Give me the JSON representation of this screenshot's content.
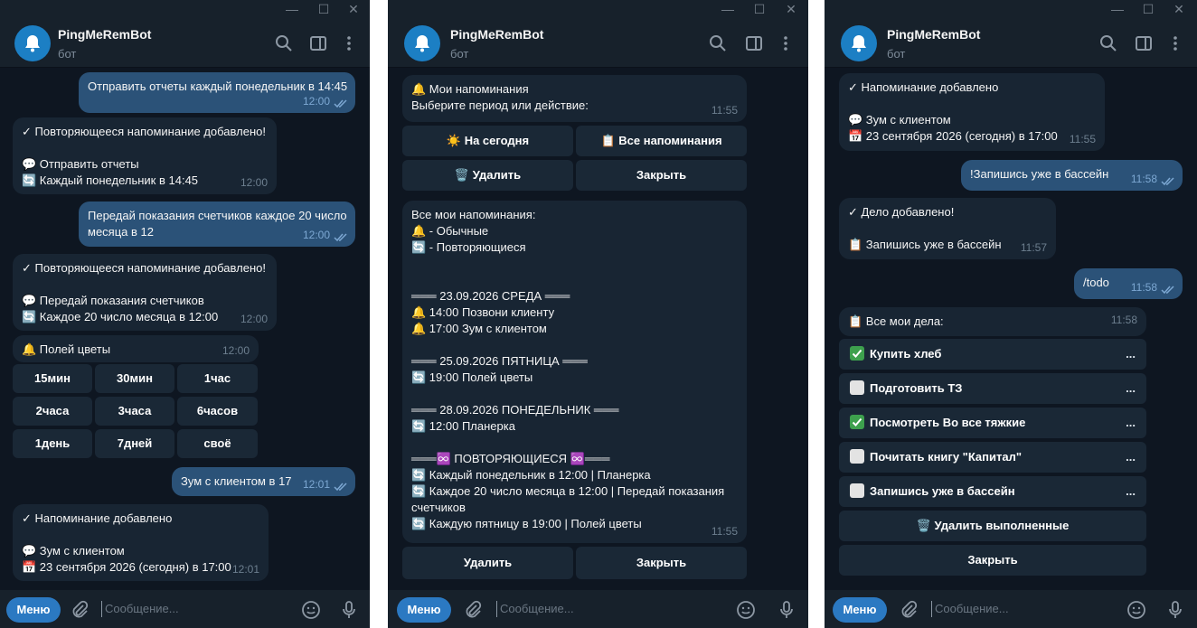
{
  "bot": {
    "name": "PingMeRemBot",
    "status": "бот"
  },
  "footer": {
    "menu_label": "Меню",
    "input_placeholder": "Сообщение..."
  },
  "window1": {
    "messages": [
      {
        "lines": [
          "Отправить отчеты каждый понедельник в 14:45"
        ],
        "time": "12:00"
      },
      {
        "lines": [
          "✓ Повторяющееся напоминание добавлено!",
          "",
          "💬 Отправить отчеты",
          "🔄 Каждый понедельник в 14:45"
        ],
        "time": "12:00"
      },
      {
        "lines": [
          "Передай показания счетчиков каждое 20 число",
          "месяца в 12"
        ],
        "time": "12:00"
      },
      {
        "lines": [
          "✓ Повторяющееся напоминание добавлено!",
          "",
          "💬 Передай показания счетчиков",
          "🔄 Каждое 20 число месяца в 12:00"
        ],
        "time": "12:00"
      },
      {
        "lines": [
          "🔔 Полей цветы"
        ],
        "time": "12:00"
      },
      {
        "lines": [
          "Зум с клиентом в 17"
        ],
        "time": "12:01"
      },
      {
        "lines": [
          "✓ Напоминание добавлено",
          "",
          "💬 Зум с клиентом",
          "📅 23 сентября 2026 (сегодня) в 17:00"
        ],
        "time": "12:01"
      }
    ],
    "snooze_buttons": [
      "15мин",
      "30мин",
      "1час",
      "2часа",
      "3часа",
      "6часов",
      "1день",
      "7дней",
      "своё"
    ]
  },
  "window2": {
    "messages": [
      {
        "lines": [
          "🔔 Мои напоминания",
          "Выберите период или действие:"
        ],
        "time": "11:55"
      },
      {
        "lines": [
          "Все мои напоминания:",
          "🔔 - Обычные",
          "🔄 - Повторяющиеся",
          "",
          "",
          "═══ 23.09.2026 СРЕДА ═══",
          "🔔 14:00 Позвони клиенту",
          "🔔 17:00 Зум с клиентом",
          "",
          "═══ 25.09.2026 ПЯТНИЦА ═══",
          "🔄 19:00 Полей цветы",
          "",
          "═══ 28.09.2026 ПОНЕДЕЛЬНИК ═══",
          "🔄 12:00 Планерка",
          "",
          "═══♾️ ПОВТОРЯЮЩИЕСЯ ♾️═══",
          "🔄 Каждый понедельник в 12:00 | Планерка",
          "🔄 Каждое 20 число месяца в 12:00 | Передай показания",
          "счетчиков",
          "🔄 Каждую пятницу в 19:00 | Полей цветы"
        ],
        "time": "11:55"
      }
    ],
    "menu_buttons": [
      "☀️ На сегодня",
      "📋 Все напоминания",
      "🗑️ Удалить",
      "Закрыть"
    ],
    "bottom_buttons": [
      "Удалить",
      "Закрыть"
    ]
  },
  "window3": {
    "messages": [
      {
        "lines": [
          "✓ Напоминание добавлено",
          "",
          "💬 Зум с клиентом",
          "📅 23 сентября 2026 (сегодня) в 17:00"
        ],
        "time": "11:55"
      },
      {
        "lines": [
          "!Запишись уже в бассейн"
        ],
        "time": "11:58"
      },
      {
        "lines": [
          "✓ Дело добавлено!",
          "",
          "📋 Запишись уже в бассейн"
        ],
        "time": "11:57"
      },
      {
        "lines": [
          "/todo"
        ],
        "time": "11:58"
      },
      {
        "lines": [
          "📋 Все мои дела:"
        ],
        "time": "11:58"
      }
    ],
    "todos": [
      {
        "label": "Купить хлеб",
        "done": true,
        "more": "..."
      },
      {
        "label": "Подготовить ТЗ",
        "done": false,
        "more": "..."
      },
      {
        "label": "Посмотреть Во все тяжкие",
        "done": true,
        "more": "..."
      },
      {
        "label": "Почитать книгу \"Капитал\"",
        "done": false,
        "more": "..."
      },
      {
        "label": "Запишись уже в бассейн",
        "done": false,
        "more": "..."
      }
    ],
    "actions": [
      "🗑️ Удалить выполненные",
      "Закрыть"
    ]
  },
  "colors": {
    "chat_bg": "#0e1621",
    "header_bg": "#17212b",
    "incoming": "#182533",
    "outgoing": "#2b5278",
    "accent": "#2b79c2",
    "keyboard_button": "#1a2836"
  }
}
